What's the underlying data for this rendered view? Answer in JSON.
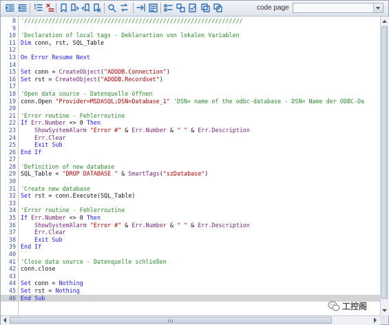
{
  "toolbar": {
    "buttons": [
      {
        "name": "indent-icon",
        "color": "#2f6fb8"
      },
      {
        "name": "outdent-icon",
        "color": "#2f6fb8"
      },
      {
        "name": "comment-lines-icon",
        "color": "#2f6fb8"
      },
      {
        "name": "uncomment-lines-icon",
        "color": "#b02020"
      },
      {
        "name": "bookmark-toggle-icon",
        "color": "#2f6fb8"
      },
      {
        "name": "bookmark-next-icon",
        "color": "#2f6fb8"
      },
      {
        "name": "bookmark-prev-icon",
        "color": "#2f6fb8"
      },
      {
        "name": "bookmark-clear-icon",
        "color": "#2f6fb8"
      },
      {
        "name": "find-icon",
        "color": "#2f6fb8"
      },
      {
        "name": "replace-icon",
        "color": "#2f6fb8"
      },
      {
        "name": "go-to-line-icon",
        "color": "#2f6fb8"
      },
      {
        "name": "properties-icon",
        "color": "#2f6fb8"
      },
      {
        "name": "symbol-list-icon",
        "color": "#2f6fb8"
      },
      {
        "name": "cross-reference-icon",
        "color": "#2f6fb8"
      },
      {
        "name": "syntax-check-icon",
        "color": "#2f6fb8"
      },
      {
        "name": "tag-list-icon",
        "color": "#2f6fb8"
      },
      {
        "name": "object-browser-icon",
        "color": "#2f6fb8"
      }
    ],
    "code_page_label": "code page",
    "code_page_value": ""
  },
  "editor": {
    "colors": {
      "comment": "#2e8b2e",
      "keyword": "#1a1aff",
      "builtin": "#7a1f7a",
      "string": "#b00000",
      "line_number": "#3b55a0",
      "highlight": "#d4d4d4"
    },
    "highlighted_line": 46,
    "lines": [
      {
        "n": "8",
        "tokens": [
          [
            "comment",
            "'///////////////////////////////////////////////////////////////"
          ]
        ]
      },
      {
        "n": "9",
        "tokens": []
      },
      {
        "n": "10",
        "tokens": [
          [
            "comment",
            "'Declaration of local tags - Deklarartion von lokalen Variablen"
          ]
        ]
      },
      {
        "n": "11",
        "tokens": [
          [
            "keyword",
            "Dim"
          ],
          [
            "plain",
            " conn, rst, SQL_Table"
          ]
        ]
      },
      {
        "n": "12",
        "tokens": []
      },
      {
        "n": "13",
        "tokens": [
          [
            "keyword",
            "On Error Resume Next"
          ]
        ]
      },
      {
        "n": "14",
        "tokens": []
      },
      {
        "n": "15",
        "tokens": [
          [
            "keyword",
            "Set"
          ],
          [
            "plain",
            " conn = "
          ],
          [
            "builtin",
            "CreateObject"
          ],
          [
            "plain",
            "("
          ],
          [
            "string",
            "\"ADODB.Connection\""
          ],
          [
            "plain",
            ")"
          ]
        ]
      },
      {
        "n": "16",
        "tokens": [
          [
            "keyword",
            "Set"
          ],
          [
            "plain",
            " rst = "
          ],
          [
            "builtin",
            "CreateObject"
          ],
          [
            "plain",
            "("
          ],
          [
            "string",
            "\"ADODB.Recordset\""
          ],
          [
            "plain",
            ")"
          ]
        ]
      },
      {
        "n": "17",
        "tokens": []
      },
      {
        "n": "18",
        "tokens": [
          [
            "comment",
            "'Open data source - Datenquelle öffnen"
          ]
        ]
      },
      {
        "n": "19",
        "tokens": [
          [
            "plain",
            "conn.Open "
          ],
          [
            "string",
            "\"Provider=MSDASQL;DSN=Database_1\""
          ],
          [
            "plain",
            " "
          ],
          [
            "comment",
            "'DSN= name of the odbc-database - DSN= Name der ODBC-Da"
          ]
        ]
      },
      {
        "n": "20",
        "tokens": []
      },
      {
        "n": "21",
        "tokens": [
          [
            "comment",
            "'Error routine - Fehlerroutine"
          ]
        ]
      },
      {
        "n": "22",
        "tokens": [
          [
            "keyword",
            "If"
          ],
          [
            "plain",
            " "
          ],
          [
            "builtin",
            "Err.Number"
          ],
          [
            "plain",
            " <> 0 "
          ],
          [
            "keyword",
            "Then"
          ]
        ]
      },
      {
        "n": "23",
        "tokens": [
          [
            "plain",
            "    "
          ],
          [
            "builtin",
            "ShowSystemAlarm"
          ],
          [
            "plain",
            " "
          ],
          [
            "string",
            "\"Error #\""
          ],
          [
            "plain",
            " & "
          ],
          [
            "builtin",
            "Err.Number"
          ],
          [
            "plain",
            " & "
          ],
          [
            "string",
            "\" \""
          ],
          [
            "plain",
            " & "
          ],
          [
            "builtin",
            "Err.Description"
          ]
        ]
      },
      {
        "n": "24",
        "tokens": [
          [
            "plain",
            "    "
          ],
          [
            "builtin",
            "Err.Clear"
          ]
        ]
      },
      {
        "n": "25",
        "tokens": [
          [
            "plain",
            "    "
          ],
          [
            "keyword",
            "Exit Sub"
          ]
        ]
      },
      {
        "n": "26",
        "tokens": [
          [
            "keyword",
            "End If"
          ]
        ]
      },
      {
        "n": "27",
        "tokens": []
      },
      {
        "n": "28",
        "tokens": [
          [
            "comment",
            "'Definition of new database"
          ]
        ]
      },
      {
        "n": "29",
        "tokens": [
          [
            "plain",
            "SQL_Table = "
          ],
          [
            "string",
            "\"DROP DATABASE \""
          ],
          [
            "plain",
            " & "
          ],
          [
            "builtin",
            "SmartTags"
          ],
          [
            "plain",
            "("
          ],
          [
            "string",
            "\"szDatabase\""
          ],
          [
            "plain",
            ")"
          ]
        ]
      },
      {
        "n": "30",
        "tokens": []
      },
      {
        "n": "31",
        "tokens": [
          [
            "comment",
            "'Create new database"
          ]
        ]
      },
      {
        "n": "32",
        "tokens": [
          [
            "keyword",
            "Set"
          ],
          [
            "plain",
            " rst = conn.Execute(SQL_Table)"
          ]
        ]
      },
      {
        "n": "33",
        "tokens": []
      },
      {
        "n": "34",
        "tokens": [
          [
            "comment",
            "'Error routine - Fehlerroutine"
          ]
        ]
      },
      {
        "n": "35",
        "tokens": [
          [
            "keyword",
            "If"
          ],
          [
            "plain",
            " "
          ],
          [
            "builtin",
            "Err.Number"
          ],
          [
            "plain",
            " <> 0 "
          ],
          [
            "keyword",
            "Then"
          ]
        ]
      },
      {
        "n": "36",
        "tokens": [
          [
            "plain",
            "    "
          ],
          [
            "builtin",
            "ShowSystemAlarm"
          ],
          [
            "plain",
            " "
          ],
          [
            "string",
            "\"Error #\""
          ],
          [
            "plain",
            " & "
          ],
          [
            "builtin",
            "Err.Number"
          ],
          [
            "plain",
            " & "
          ],
          [
            "string",
            "\" \""
          ],
          [
            "plain",
            " & "
          ],
          [
            "builtin",
            "Err.Description"
          ]
        ]
      },
      {
        "n": "37",
        "tokens": [
          [
            "plain",
            "    "
          ],
          [
            "builtin",
            "Err.Clear"
          ]
        ]
      },
      {
        "n": "38",
        "tokens": [
          [
            "plain",
            "    "
          ],
          [
            "keyword",
            "Exit Sub"
          ]
        ]
      },
      {
        "n": "39",
        "tokens": [
          [
            "keyword",
            "End If"
          ]
        ]
      },
      {
        "n": "40",
        "tokens": []
      },
      {
        "n": "41",
        "tokens": [
          [
            "comment",
            "'Close data source - Datenquelle schließen"
          ]
        ]
      },
      {
        "n": "42",
        "tokens": [
          [
            "plain",
            "conn.close"
          ]
        ]
      },
      {
        "n": "43",
        "tokens": []
      },
      {
        "n": "44",
        "tokens": [
          [
            "keyword",
            "Set"
          ],
          [
            "plain",
            " conn = "
          ],
          [
            "keyword",
            "Nothing"
          ]
        ]
      },
      {
        "n": "45",
        "tokens": [
          [
            "keyword",
            "Set"
          ],
          [
            "plain",
            " rst = "
          ],
          [
            "keyword",
            "Nothing"
          ]
        ]
      },
      {
        "n": "46",
        "tokens": [
          [
            "keyword",
            "End Sub"
          ]
        ]
      }
    ]
  },
  "watermark": {
    "text": "工控阁",
    "icon": "wechat-icon"
  }
}
